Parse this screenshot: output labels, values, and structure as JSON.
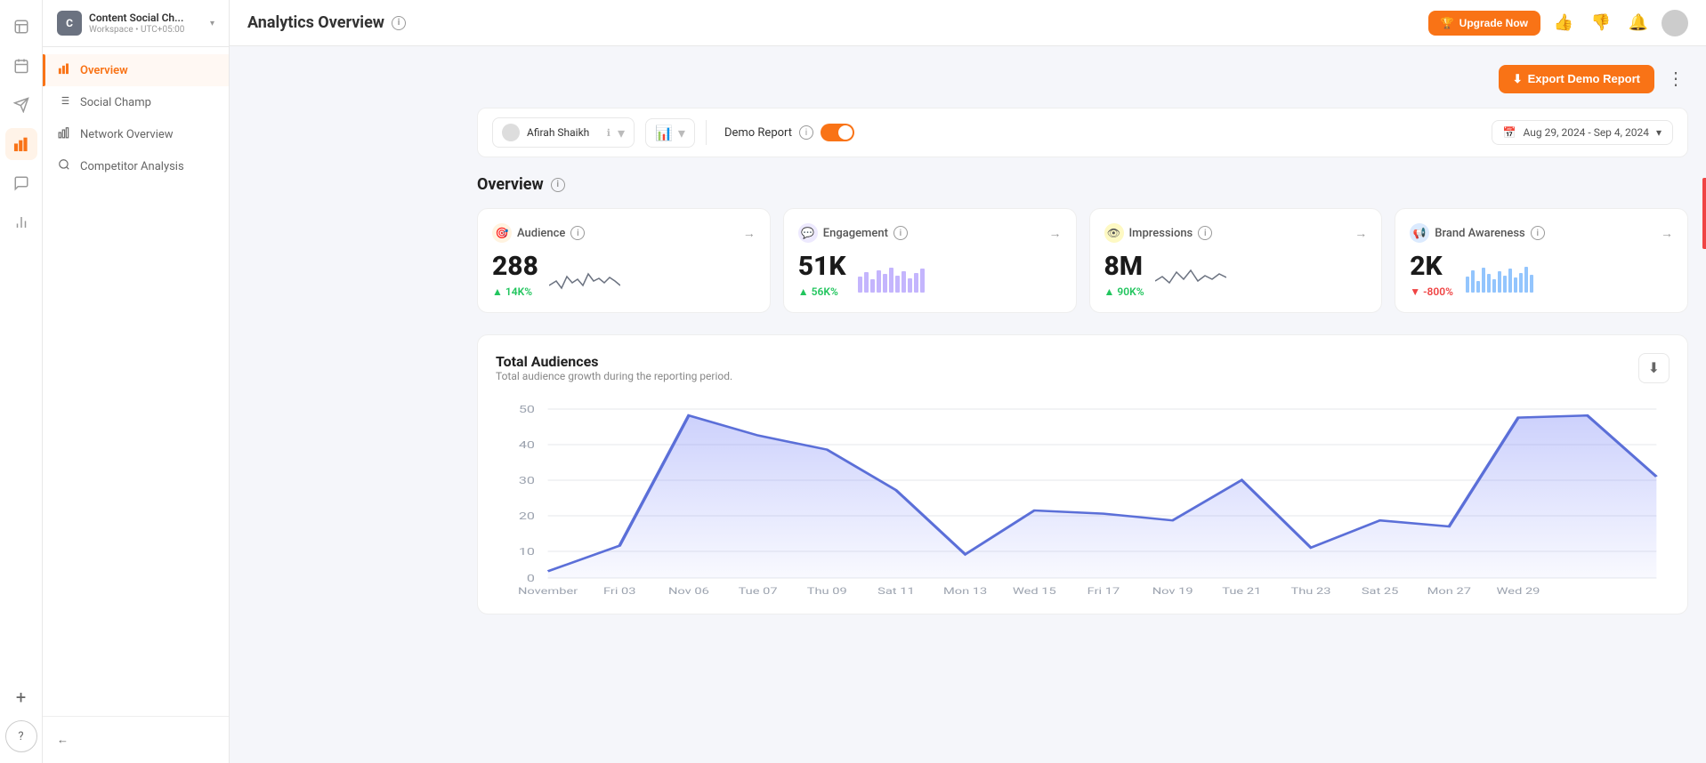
{
  "app": {
    "title": "Social Champ",
    "workspace_initial": "C",
    "workspace_name": "Content Social Ch...",
    "workspace_sub": "Workspace • UTC+05:00"
  },
  "topbar": {
    "title": "Analytics Overview",
    "export_btn": "Export Demo Report",
    "upgrade_btn": "Upgrade Now"
  },
  "filter": {
    "account_name": "Afirah Shaikh",
    "demo_report_label": "Demo Report",
    "date_range": "Aug 29, 2024 - Sep 4, 2024"
  },
  "overview": {
    "title": "Overview",
    "cards": [
      {
        "id": "audience",
        "label": "Audience",
        "icon": "🎯",
        "icon_bg": "#fff3e0",
        "value": "288",
        "change": "14K%",
        "change_positive": true
      },
      {
        "id": "engagement",
        "label": "Engagement",
        "icon": "💬",
        "icon_bg": "#ede9fe",
        "value": "51K",
        "change": "56K%",
        "change_positive": true
      },
      {
        "id": "impressions",
        "label": "Impressions",
        "icon": "👁",
        "icon_bg": "#fef9c3",
        "value": "8M",
        "change": "90K%",
        "change_positive": true
      },
      {
        "id": "brand_awareness",
        "label": "Brand Awareness",
        "icon": "📢",
        "icon_bg": "#dbeafe",
        "value": "2K",
        "change": "-800%",
        "change_positive": false
      }
    ]
  },
  "chart": {
    "title": "Total Audiences",
    "subtitle": "Total audience growth during the reporting period.",
    "x_labels": [
      "November",
      "Fri 03",
      "Nov 06",
      "Tue 07",
      "Thu 09",
      "Sat 11",
      "Mon 13",
      "Wed 15",
      "Fri 17",
      "Nov 19",
      "Tue 21",
      "Thu 23",
      "Sat 25",
      "Mon 27",
      "Wed 29"
    ],
    "y_labels": [
      "0",
      "10",
      "20",
      "30",
      "40",
      "50"
    ],
    "data_points": [
      2,
      8,
      48,
      42,
      38,
      26,
      7,
      20,
      19,
      17,
      29,
      9,
      17,
      15,
      47,
      48,
      30
    ]
  },
  "sidebar": {
    "nav_items": [
      {
        "id": "overview",
        "label": "Overview",
        "active": true
      },
      {
        "id": "social-champ",
        "label": "Social Champ",
        "active": false
      },
      {
        "id": "network-overview",
        "label": "Network Overview",
        "active": false
      },
      {
        "id": "competitor-analysis",
        "label": "Competitor Analysis",
        "active": false
      }
    ]
  },
  "icons": {
    "calendar": "📅",
    "send": "✈",
    "chart": "📊",
    "bubble": "💬",
    "bars": "📈",
    "plus": "+",
    "question": "?",
    "chevron_down": "▾",
    "chevron_left": "←",
    "info": "i",
    "arrow_right": "→",
    "download": "⬇"
  }
}
